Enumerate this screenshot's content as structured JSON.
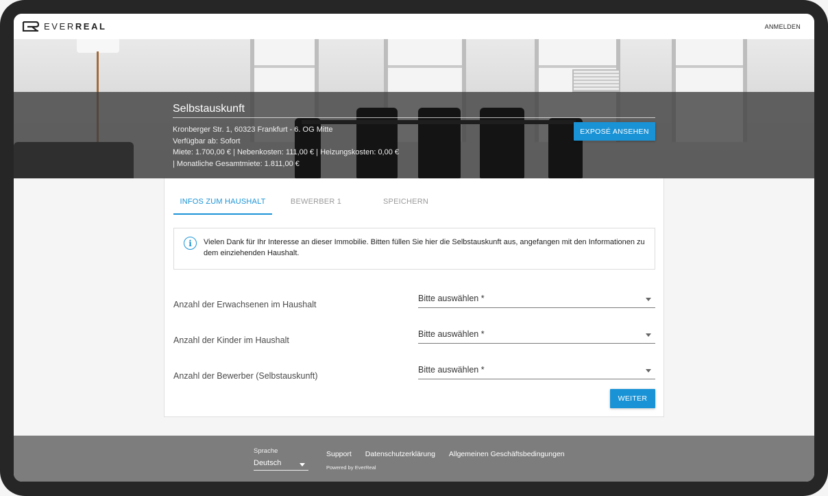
{
  "header": {
    "logo_text_light": "EVER",
    "logo_text_bold": "REAL",
    "login_label": "ANMELDEN"
  },
  "hero": {
    "title": "Selbstauskunft",
    "address": "Kronberger Str. 1, 60323 Frankfurt - 6. OG Mitte",
    "available": "Verfügbar ab: Sofort",
    "costs_line1": "Miete: 1.700,00 € | Nebenkosten: 111,00 € | Heizungskosten: 0,00 €",
    "costs_line2": "| Monatliche Gesamtmiete: 1.811,00 €",
    "expose_button": "EXPOSÉ ANSEHEN"
  },
  "tabs": [
    {
      "label": "INFOS ZUM HAUSHALT",
      "active": true
    },
    {
      "label": "BEWERBER 1",
      "active": false
    },
    {
      "label": "SPEICHERN",
      "active": false
    }
  ],
  "info": {
    "icon": "info-icon",
    "text": "Vielen Dank für Ihr Interesse an dieser Immobilie. Bitten füllen Sie hier die Selbstauskunft aus, angefangen mit den Informationen zu dem einziehenden Haushalt."
  },
  "form": {
    "fields": [
      {
        "label": "Anzahl der Erwachsenen im Haushalt",
        "placeholder": "Bitte auswählen *"
      },
      {
        "label": "Anzahl der Kinder im Haushalt",
        "placeholder": "Bitte auswählen *"
      },
      {
        "label": "Anzahl der Bewerber (Selbstauskunft)",
        "placeholder": "Bitte auswählen *"
      }
    ],
    "next_button": "WEITER"
  },
  "footer": {
    "language_label": "Sprache",
    "language_value": "Deutsch",
    "links": [
      "Support",
      "Datenschutzerklärung",
      "Allgemeinen Geschäftsbedingungen"
    ],
    "powered_by": "Powered by EverReal"
  },
  "colors": {
    "accent": "#1a93d6",
    "footer_bg": "#7d7d7d",
    "frame": "#262626"
  }
}
